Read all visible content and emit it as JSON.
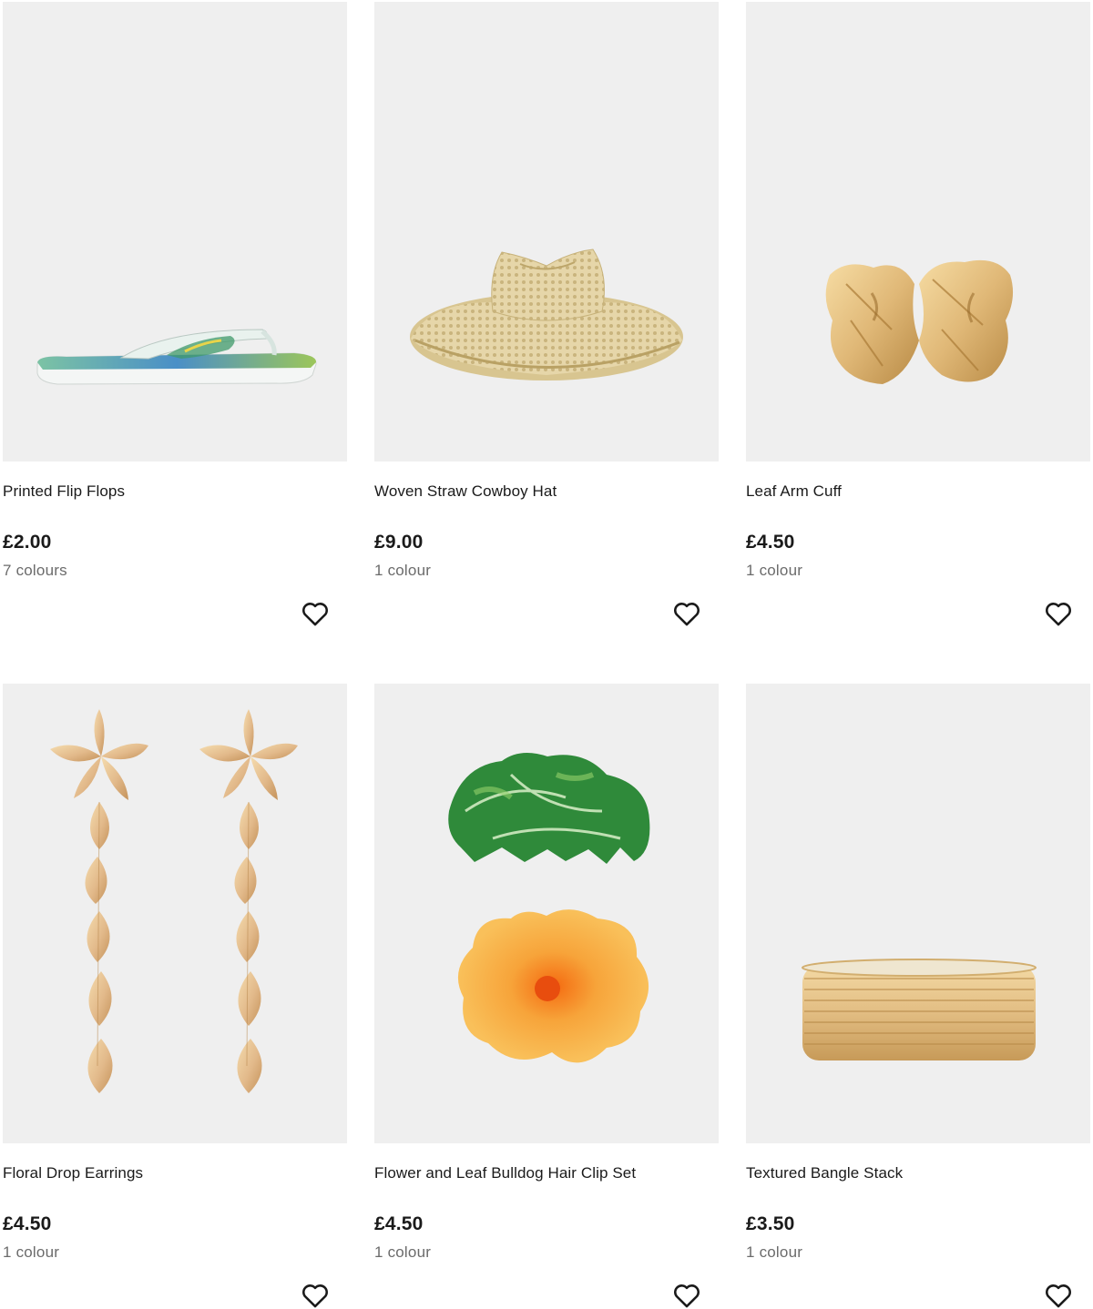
{
  "products": [
    {
      "name": "Printed Flip Flops",
      "price": "£2.00",
      "colours": "7 colours",
      "image_icon": "flip-flop-image",
      "wishlist_icon": "heart-icon"
    },
    {
      "name": "Woven Straw Cowboy Hat",
      "price": "£9.00",
      "colours": "1 colour",
      "image_icon": "straw-hat-image",
      "wishlist_icon": "heart-icon"
    },
    {
      "name": "Leaf Arm Cuff",
      "price": "£4.50",
      "colours": "1 colour",
      "image_icon": "leaf-cuff-image",
      "wishlist_icon": "heart-icon"
    },
    {
      "name": "Floral Drop Earrings",
      "price": "£4.50",
      "colours": "1 colour",
      "image_icon": "floral-earrings-image",
      "wishlist_icon": "heart-icon"
    },
    {
      "name": "Flower and Leaf Bulldog Hair Clip Set",
      "price": "£4.50",
      "colours": "1 colour",
      "image_icon": "hair-clip-image",
      "wishlist_icon": "heart-icon"
    },
    {
      "name": "Textured Bangle Stack",
      "price": "£3.50",
      "colours": "1 colour",
      "image_icon": "bangle-stack-image",
      "wishlist_icon": "heart-icon"
    }
  ],
  "colors": {
    "image_background": "#efefef",
    "text": "#1a1a1a",
    "muted_text": "#6b6b6b",
    "gold": "#e0b877"
  }
}
